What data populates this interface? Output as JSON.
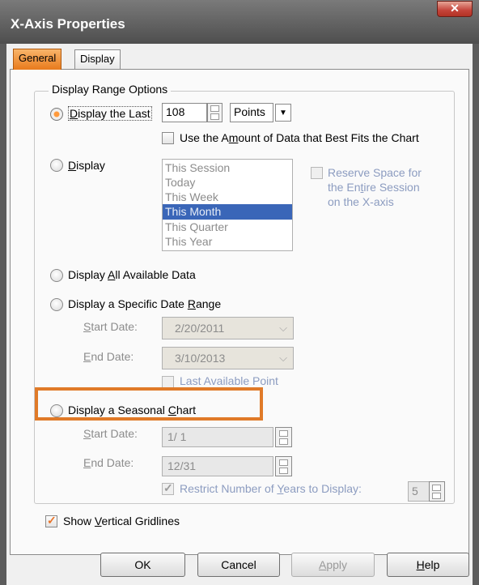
{
  "window": {
    "title": "X-Axis Properties",
    "close_label": "✕"
  },
  "tabs": [
    {
      "label": "General",
      "selected": true
    },
    {
      "label": "Display",
      "selected": false
    }
  ],
  "group": {
    "label": "Display Range Options"
  },
  "display_last": {
    "label_pre": "",
    "label_u": "D",
    "label_post": "isplay the Last",
    "value": "108",
    "unit": "Points",
    "best_fit_pre": "Use the A",
    "best_fit_u": "m",
    "best_fit_post": "ount of Data that Best Fits the Chart"
  },
  "display_period": {
    "label_u": "D",
    "label_post": "isplay",
    "options": [
      "This Session",
      "Today",
      "This Week",
      "This Month",
      "This Quarter",
      "This Year"
    ],
    "selected": "This Month",
    "reserve_pre": "Reserve Space for",
    "reserve_mid_pre": "the En",
    "reserve_mid_u": "t",
    "reserve_mid_post": "ire Session",
    "reserve_post": "on the X-axis"
  },
  "all_data": {
    "pre": "Display ",
    "u": "A",
    "post": "ll Available Data"
  },
  "date_range": {
    "pre": "Display a Specific Date ",
    "u": "R",
    "post": "ange",
    "start_label_u": "S",
    "start_label_post": "tart Date:",
    "start_value": "2/20/2011",
    "end_label_u": "E",
    "end_label_post": "nd Date:",
    "end_value": "3/10/2013",
    "last_point": "Last Available Point"
  },
  "seasonal": {
    "pre": "Display a Seasonal ",
    "u": "C",
    "post": "hart",
    "start_label_u": "S",
    "start_label_post": "tart Date:",
    "start_value": "1/ 1",
    "end_label_u": "E",
    "end_label_post": "nd Date:",
    "end_value": "12/31",
    "restrict_pre": "Restrict Number of ",
    "restrict_u": "Y",
    "restrict_post": "ears to Display:",
    "years_value": "5"
  },
  "gridlines": {
    "pre": "Show ",
    "u": "V",
    "post": "ertical Gridlines"
  },
  "buttons": {
    "ok": "OK",
    "cancel": "Cancel",
    "apply_u": "A",
    "apply_post": "pply",
    "help_u": "H",
    "help_post": "elp"
  },
  "colors": {
    "accent": "#e07a28",
    "selection": "#3a66b8"
  }
}
